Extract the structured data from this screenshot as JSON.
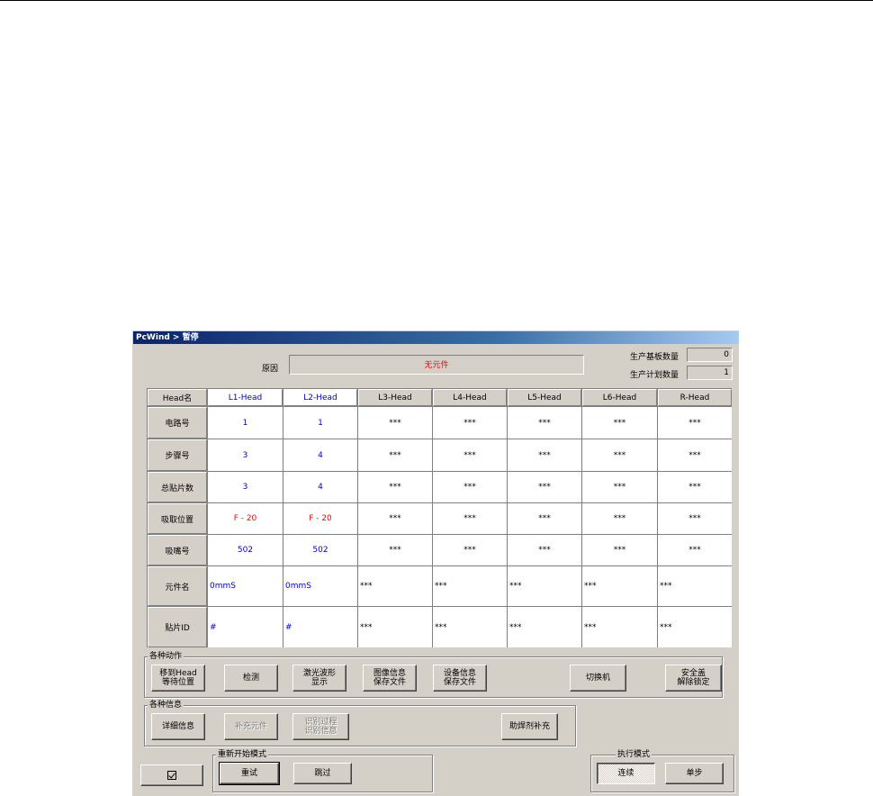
{
  "window": {
    "title": "PcWind > 暂停"
  },
  "reason": {
    "label": "原因",
    "value": "无元件"
  },
  "counts": {
    "boards_label": "生产基板数量",
    "boards_value": "0",
    "plan_label": "生产计划数量",
    "plan_value": "1"
  },
  "grid": {
    "header_label": "Head名",
    "heads": [
      "L1-Head",
      "L2-Head",
      "L3-Head",
      "L4-Head",
      "L5-Head",
      "L6-Head",
      "R-Head"
    ],
    "rows": [
      {
        "label": "电路号",
        "values": [
          "1",
          "1",
          "***",
          "***",
          "***",
          "***",
          "***"
        ]
      },
      {
        "label": "步骤号",
        "values": [
          "3",
          "4",
          "***",
          "***",
          "***",
          "***",
          "***"
        ]
      },
      {
        "label": "总贴片数",
        "values": [
          "3",
          "4",
          "***",
          "***",
          "***",
          "***",
          "***"
        ]
      },
      {
        "label": "吸取位置",
        "values": [
          "F - 20",
          "F - 20",
          "***",
          "***",
          "***",
          "***",
          "***"
        ]
      },
      {
        "label": "吸嘴号",
        "values": [
          "502",
          "502",
          "***",
          "***",
          "***",
          "***",
          "***"
        ]
      },
      {
        "label": "元件名",
        "values": [
          "0mmS",
          "0mmS",
          "***",
          "***",
          "***",
          "***",
          "***"
        ]
      },
      {
        "label": "贴片ID",
        "values": [
          "#",
          "#",
          "***",
          "***",
          "***",
          "***",
          "***"
        ]
      }
    ]
  },
  "actions": {
    "title": "各种动作",
    "move_head": "移到Head\n等待位置",
    "check": "检测",
    "laser": "激光波形\n显示",
    "image_save": "图像信息\n保存文件",
    "device_save": "设备信息\n保存文件",
    "switch": "切换机",
    "unlock": "安全盖\n解除锁定"
  },
  "info": {
    "title": "各种信息",
    "detail": "详细信息",
    "supplement": "补充元件",
    "recog": "识别过程\n识别信息",
    "replenish": "助焊剂补充"
  },
  "restart": {
    "title": "重新开始模式",
    "retry": "重试",
    "skip": "跳过"
  },
  "exec": {
    "title": "执行模式",
    "continuous": "连续",
    "step": "单步"
  },
  "icons": {
    "confirm": "checkbox-icon"
  }
}
